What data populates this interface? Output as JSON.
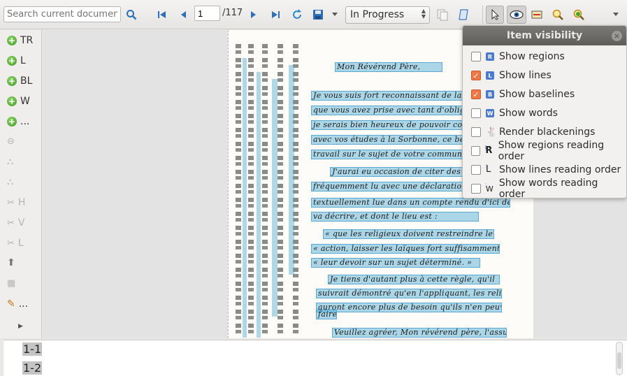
{
  "toolbar": {
    "search_placeholder": "Search current document...",
    "page_value": "1",
    "page_total": "/117",
    "status_value": "In Progress"
  },
  "left_panel": {
    "add_items": [
      "TR",
      "L",
      "BL",
      "W",
      "..."
    ],
    "disabled_items": [
      "H",
      "V",
      "L"
    ],
    "extra_label": "..."
  },
  "document": {
    "heading": "Mon Révérend Père,",
    "lines": [
      "Je vous suis fort reconnaissant de la peine",
      "que vous avez prise avec tant d'obligeance",
      "je serais bien heureux de pouvoir contribuer",
      "avec vos études à la Sorbonne, ce beau",
      "travail sur le sujet de votre commune",
      "J'aurai eu occasion de citer des",
      "fréquemment lu avec une déclaration",
      "textuellement lue dans un compte rendu d'ici de",
      "va décrire, et dont le lieu est :",
      "« que les religieux doivent restreindre leur",
      "« action, laisser les laïques fort suffisamment",
      "« leur devoir sur un sujet déterminé. »",
      "Je tiens d'autant plus à cette règle, qu'il",
      "suivrait démontré qu'en l'appliquant, les religieux",
      "auront encore plus de besoin qu'ils n'en peuvent",
      "faire.",
      "Veuillez agréer, Mon révérend père, l'assurance"
    ]
  },
  "item_visibility": {
    "title": "Item visibility",
    "options": [
      {
        "label": "Show regions",
        "checked": false,
        "icon": "R"
      },
      {
        "label": "Show lines",
        "checked": true,
        "icon": "L"
      },
      {
        "label": "Show baselines",
        "checked": true,
        "icon": "B"
      },
      {
        "label": "Show words",
        "checked": false,
        "icon": "W"
      },
      {
        "label": "Render blackenings",
        "checked": false,
        "icon": "rabbit-icon"
      },
      {
        "label": "Show regions reading order",
        "checked": false,
        "icon": "R"
      },
      {
        "label": "Show lines reading order",
        "checked": false,
        "icon": "L"
      },
      {
        "label": "Show words reading order",
        "checked": false,
        "icon": "W"
      }
    ]
  },
  "text_panel": {
    "rows": [
      "1-1",
      "1-2"
    ]
  },
  "colors": {
    "checkbox_checked": "#f07746",
    "highlight": "#5aafd7",
    "badge": "#4b7bd0"
  }
}
